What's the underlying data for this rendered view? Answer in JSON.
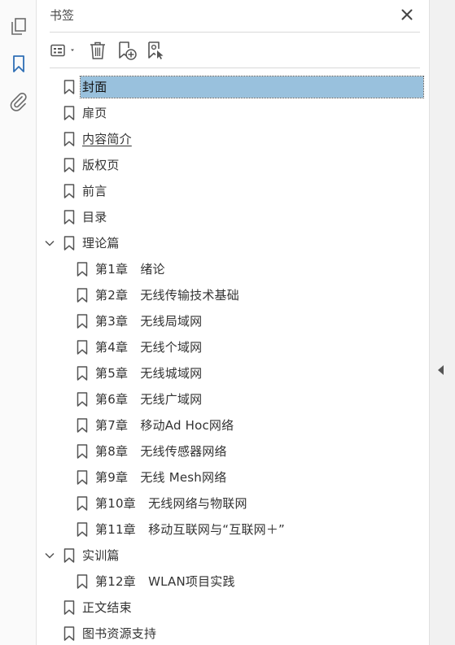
{
  "panel": {
    "title": "书签"
  },
  "icons": {
    "rail": [
      "pages-icon",
      "bookmark-icon",
      "attachment-icon"
    ],
    "toolbar": [
      "options-menu-icon",
      "delete-icon",
      "new-bookmark-icon",
      "new-bookmark-from-structure-icon"
    ]
  },
  "colors": {
    "accent": "#2f6fb5",
    "selection": "#99c1dd"
  },
  "bookmarks": [
    {
      "label": "封面",
      "level": 0,
      "selected": true,
      "expandable": false
    },
    {
      "label": "扉页",
      "level": 0,
      "selected": false,
      "expandable": false
    },
    {
      "label": "内容简介",
      "level": 0,
      "selected": false,
      "expandable": false
    },
    {
      "label": "版权页",
      "level": 0,
      "selected": false,
      "expandable": false
    },
    {
      "label": "前言",
      "level": 0,
      "selected": false,
      "expandable": false
    },
    {
      "label": "目录",
      "level": 0,
      "selected": false,
      "expandable": false
    },
    {
      "label": "理论篇",
      "level": 0,
      "selected": false,
      "expandable": true,
      "expanded": true
    },
    {
      "label": "第1章　绪论",
      "level": 1,
      "selected": false,
      "expandable": false
    },
    {
      "label": "第2章　无线传输技术基础",
      "level": 1,
      "selected": false,
      "expandable": false
    },
    {
      "label": "第3章　无线局域网",
      "level": 1,
      "selected": false,
      "expandable": false
    },
    {
      "label": "第4章　无线个域网",
      "level": 1,
      "selected": false,
      "expandable": false
    },
    {
      "label": "第5章　无线城域网",
      "level": 1,
      "selected": false,
      "expandable": false
    },
    {
      "label": "第6章　无线广域网",
      "level": 1,
      "selected": false,
      "expandable": false
    },
    {
      "label": "第7章　移动Ad Hoc网络",
      "level": 1,
      "selected": false,
      "expandable": false
    },
    {
      "label": "第8章　无线传感器网络",
      "level": 1,
      "selected": false,
      "expandable": false
    },
    {
      "label": "第9章　无线 Mesh网络",
      "level": 1,
      "selected": false,
      "expandable": false
    },
    {
      "label": "第10章　无线网络与物联网",
      "level": 1,
      "selected": false,
      "expandable": false
    },
    {
      "label": "第11章　移动互联网与“互联网＋”",
      "level": 1,
      "selected": false,
      "expandable": false
    },
    {
      "label": "实训篇",
      "level": 0,
      "selected": false,
      "expandable": true,
      "expanded": true
    },
    {
      "label": "第12章　WLAN项目实践",
      "level": 1,
      "selected": false,
      "expandable": false
    },
    {
      "label": "正文结束",
      "level": 0,
      "selected": false,
      "expandable": false
    },
    {
      "label": "图书资源支持",
      "level": 0,
      "selected": false,
      "expandable": false
    }
  ]
}
